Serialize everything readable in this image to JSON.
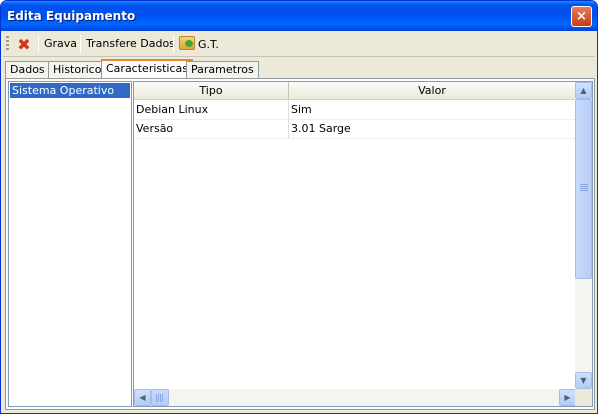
{
  "window": {
    "title": "Edita Equipamento",
    "close_label": "×"
  },
  "toolbar": {
    "delete_icon_glyph": "✖",
    "save_label": "Grava",
    "transfer_label": "Transfere Dados",
    "gt_label": "G.T."
  },
  "tabs": [
    {
      "label": "Dados",
      "active": false
    },
    {
      "label": "Historico",
      "active": false
    },
    {
      "label": "Caracteristicas",
      "active": true
    },
    {
      "label": "Parametros",
      "active": false
    }
  ],
  "left_list": {
    "items": [
      {
        "label": "Sistema Operativo",
        "selected": true
      }
    ]
  },
  "grid": {
    "columns": [
      "Tipo",
      "Valor"
    ],
    "rows": [
      [
        "Debian Linux",
        "Sim"
      ],
      [
        "Versão",
        "3.01 Sarge"
      ]
    ]
  },
  "scrollbars": {
    "up_glyph": "▲",
    "down_glyph": "▼",
    "left_glyph": "◀",
    "right_glyph": "▶"
  }
}
